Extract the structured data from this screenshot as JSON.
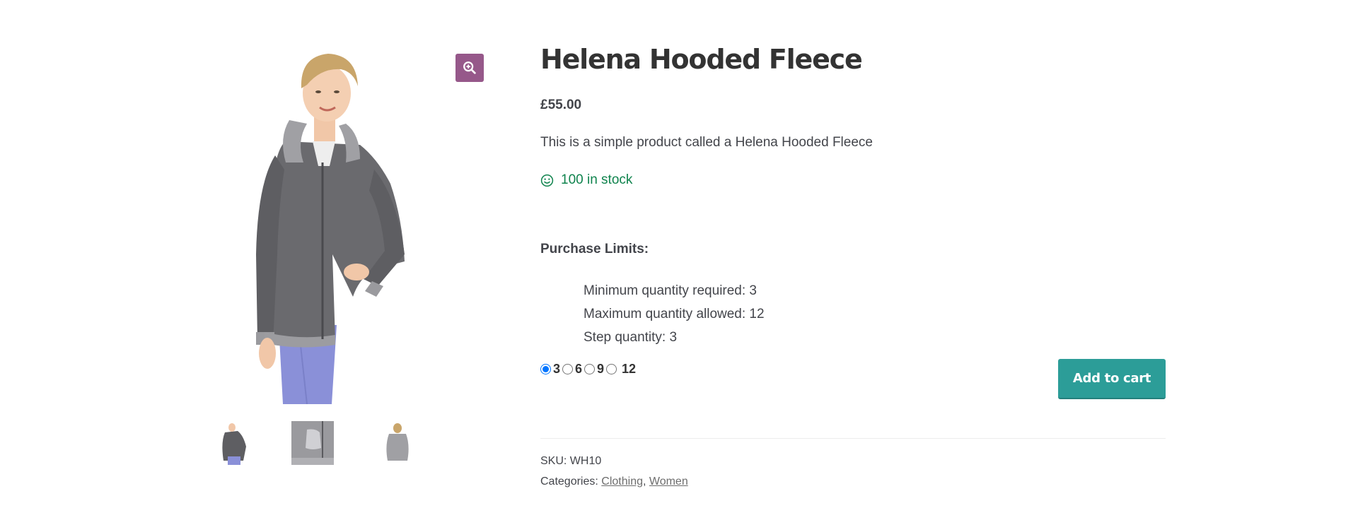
{
  "product": {
    "title": "Helena Hooded Fleece",
    "price": "£55.00",
    "description": "This is a simple product called a Helena Hooded Fleece",
    "stock": "100 in stock"
  },
  "gallery": {
    "zoom_icon": "zoom-in-icon",
    "accent": "#96588a"
  },
  "purchase_limits": {
    "heading": "Purchase Limits:",
    "items": [
      "Minimum quantity required: 3",
      "Maximum quantity allowed: 12",
      "Step quantity: 3"
    ]
  },
  "quantity": {
    "options": [
      "3",
      "6",
      "9",
      "12"
    ],
    "selected": "3"
  },
  "cart": {
    "button_label": "Add to cart",
    "color": "#2c9d98"
  },
  "meta": {
    "sku_label": "SKU:",
    "sku_value": "WH10",
    "categories_label": "Categories:",
    "categories": [
      "Clothing",
      "Women"
    ],
    "separator": ","
  },
  "colors": {
    "stock": "#0f834d",
    "text": "#43454b"
  }
}
